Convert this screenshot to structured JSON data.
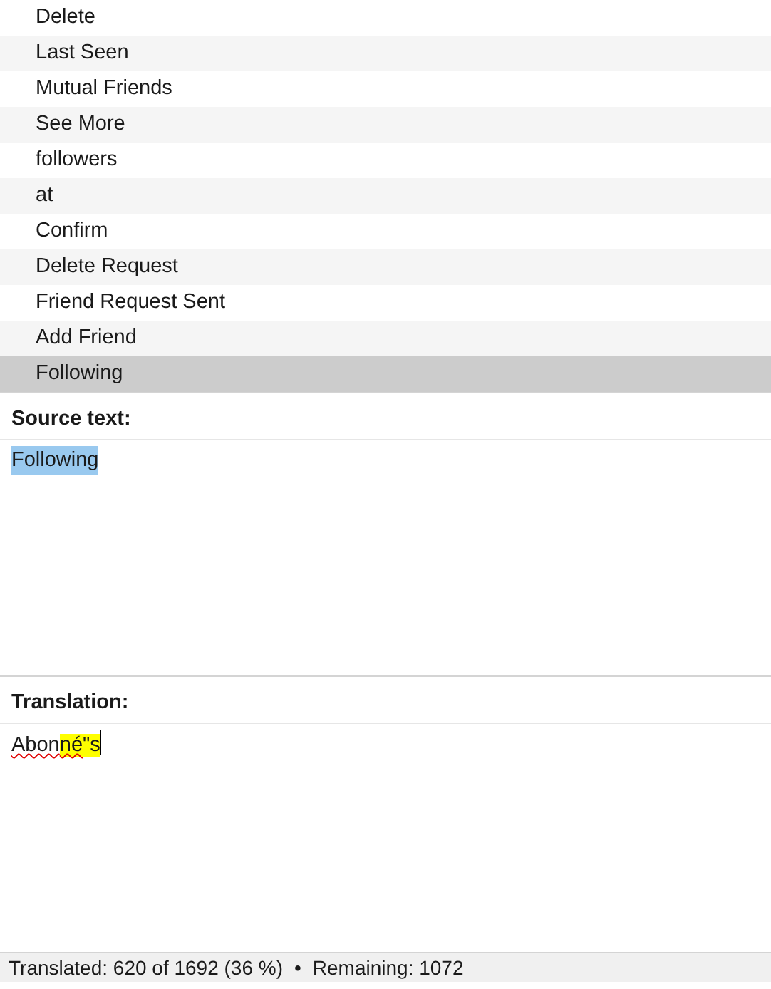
{
  "strings": [
    {
      "text": "Delete",
      "selected": false
    },
    {
      "text": "Last Seen",
      "selected": false
    },
    {
      "text": "Mutual Friends",
      "selected": false
    },
    {
      "text": "See More",
      "selected": false
    },
    {
      "text": "followers",
      "selected": false
    },
    {
      "text": "at",
      "selected": false
    },
    {
      "text": "Confirm",
      "selected": false
    },
    {
      "text": "Delete Request",
      "selected": false
    },
    {
      "text": "Friend Request Sent",
      "selected": false
    },
    {
      "text": "Add Friend",
      "selected": false
    },
    {
      "text": "Following",
      "selected": true
    }
  ],
  "source": {
    "label": "Source text:",
    "text": "Following",
    "selected": true
  },
  "translation": {
    "label": "Translation:",
    "segments": [
      {
        "text": "Abon",
        "misspelled": true,
        "highlighted": false
      },
      {
        "text": "né",
        "misspelled": true,
        "highlighted": true
      },
      {
        "text": "\"s",
        "misspelled": false,
        "highlighted": true
      }
    ]
  },
  "status_bar": {
    "translated": "Translated: 620 of 1692 (36 %)",
    "separator": "•",
    "remaining": "Remaining: 1072"
  }
}
